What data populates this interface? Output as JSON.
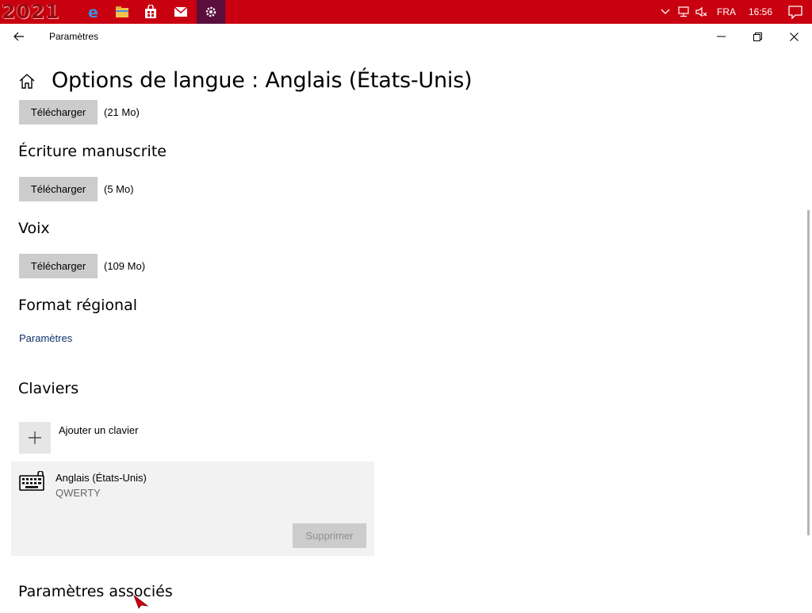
{
  "taskbar": {
    "logo_text": "2021",
    "apps": [
      {
        "name": "edge-icon",
        "active": false
      },
      {
        "name": "file-explorer-icon",
        "active": false
      },
      {
        "name": "store-icon",
        "active": false
      },
      {
        "name": "mail-icon",
        "active": false
      },
      {
        "name": "settings-gear-icon",
        "active": true
      }
    ],
    "language": "FRA",
    "clock": "16:56",
    "color": "#c8000f"
  },
  "window": {
    "app_title": "Paramètres",
    "page_title": "Options de langue : Anglais (États-Unis)"
  },
  "sections": {
    "download_1": {
      "button": "Télécharger",
      "size": "(21 Mo)"
    },
    "handwriting": {
      "heading": "Écriture manuscrite",
      "button": "Télécharger",
      "size": "(5 Mo)"
    },
    "voice": {
      "heading": "Voix",
      "button": "Télécharger",
      "size": "(109 Mo)"
    },
    "regional": {
      "heading": "Format régional",
      "link": "Paramètres"
    },
    "keyboards": {
      "heading": "Claviers",
      "add_label": "Ajouter un clavier",
      "items": [
        {
          "name": "Anglais (États-Unis)",
          "layout": "QWERTY",
          "remove_label": "Supprimer"
        }
      ]
    },
    "related": {
      "heading": "Paramètres associés"
    }
  }
}
